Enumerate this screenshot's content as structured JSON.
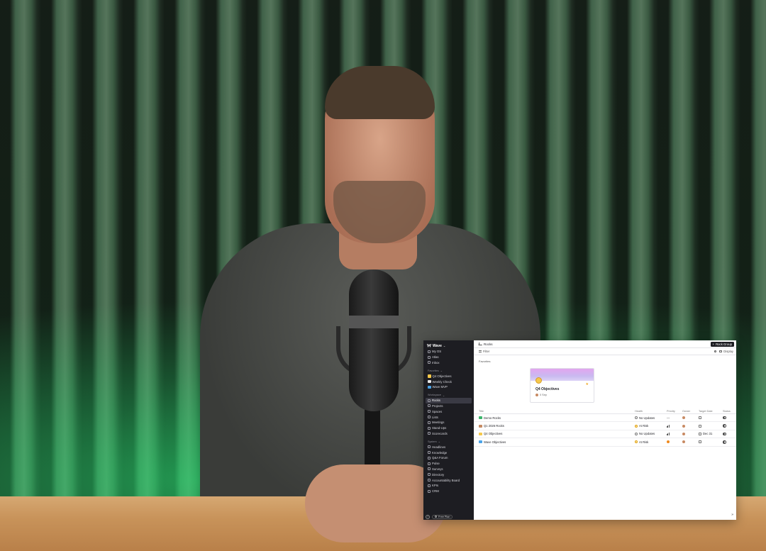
{
  "colors": {
    "sidebar_bg": "#1d1d22",
    "accent_dark": "#1d1d22",
    "at_risk": "#e1a20f",
    "urgent": "#f08a1d",
    "banner": "#e2a6ef"
  },
  "sidebar": {
    "workspace": "Wave",
    "top_items": [
      {
        "label": "My OS",
        "icon": "home-icon"
      },
      {
        "label": "Atlas",
        "icon": "atlas-icon"
      },
      {
        "label": "Inbox",
        "icon": "inbox-icon"
      }
    ],
    "favorites_label": "Favorites",
    "favorites": [
      {
        "label": "Q4 Objectives",
        "icon": "emoji-icon"
      },
      {
        "label": "Weekly Check",
        "icon": "chart-emoji-icon"
      },
      {
        "label": "Wave MVP",
        "icon": "wave-emoji-icon"
      }
    ],
    "workspace_label": "Workspace",
    "workspace_items": [
      {
        "label": "Rocks",
        "icon": "rocks-icon",
        "active": true
      },
      {
        "label": "Projects",
        "icon": "projects-icon"
      },
      {
        "label": "Spaces",
        "icon": "spaces-icon"
      },
      {
        "label": "Lists",
        "icon": "lists-icon"
      },
      {
        "label": "Meetings",
        "icon": "meetings-icon"
      },
      {
        "label": "Stand-Ups",
        "icon": "standups-icon"
      },
      {
        "label": "Scorecards",
        "icon": "scorecards-icon"
      }
    ],
    "system_label": "System",
    "system_items": [
      {
        "label": "Headlines",
        "icon": "headlines-icon"
      },
      {
        "label": "Knowledge",
        "icon": "knowledge-icon"
      },
      {
        "label": "Q&A Forum",
        "icon": "forum-icon"
      },
      {
        "label": "Pulse",
        "icon": "pulse-icon"
      },
      {
        "label": "Surveys",
        "icon": "surveys-icon"
      },
      {
        "label": "Directory",
        "icon": "directory-icon"
      },
      {
        "label": "Accountability Board",
        "icon": "board-icon"
      },
      {
        "label": "KPIs",
        "icon": "kpi-icon"
      },
      {
        "label": "CRM",
        "icon": "crm-icon"
      }
    ],
    "help": "?",
    "plan": "Free Plan"
  },
  "header": {
    "breadcrumb": "Rocks",
    "new_button": "Rock Group"
  },
  "toolbar": {
    "filter": "Filter",
    "display": "Display"
  },
  "favorites_section": {
    "label": "Favorites",
    "card": {
      "title": "Q4 Objectives",
      "meta": "0 Sep"
    }
  },
  "table": {
    "columns": [
      "Title",
      "Health",
      "Priority",
      "Owner",
      "Target Date",
      "Status"
    ],
    "rows": [
      {
        "title": "Demo Rocks",
        "health": "No Updates",
        "priority": "---",
        "target": ""
      },
      {
        "title": "Q1 2026 Rocks",
        "health": "At Risk",
        "priority": "",
        "target": ""
      },
      {
        "title": "Q4 Objectives",
        "health": "No Updates",
        "priority": "",
        "target": "Dec 31"
      },
      {
        "title": "Wave Objectives",
        "health": "At Risk",
        "priority": "",
        "target": ""
      }
    ]
  }
}
